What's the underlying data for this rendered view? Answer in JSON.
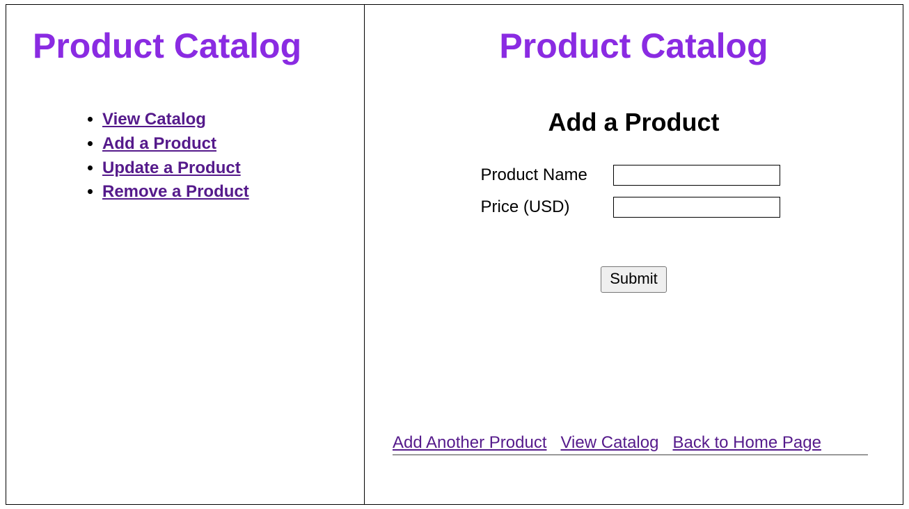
{
  "left": {
    "title": "Product Catalog",
    "nav": [
      "View Catalog",
      "Add a Product",
      "Update a Product",
      "Remove a Product"
    ]
  },
  "right": {
    "title": "Product Catalog",
    "subtitle": "Add a Product",
    "form": {
      "name_label": "Product Name",
      "name_value": "",
      "price_label": "Price (USD)",
      "price_value": "",
      "submit_label": "Submit"
    },
    "footer_links": [
      "Add Another Product",
      "View Catalog",
      "Back to Home Page"
    ]
  }
}
